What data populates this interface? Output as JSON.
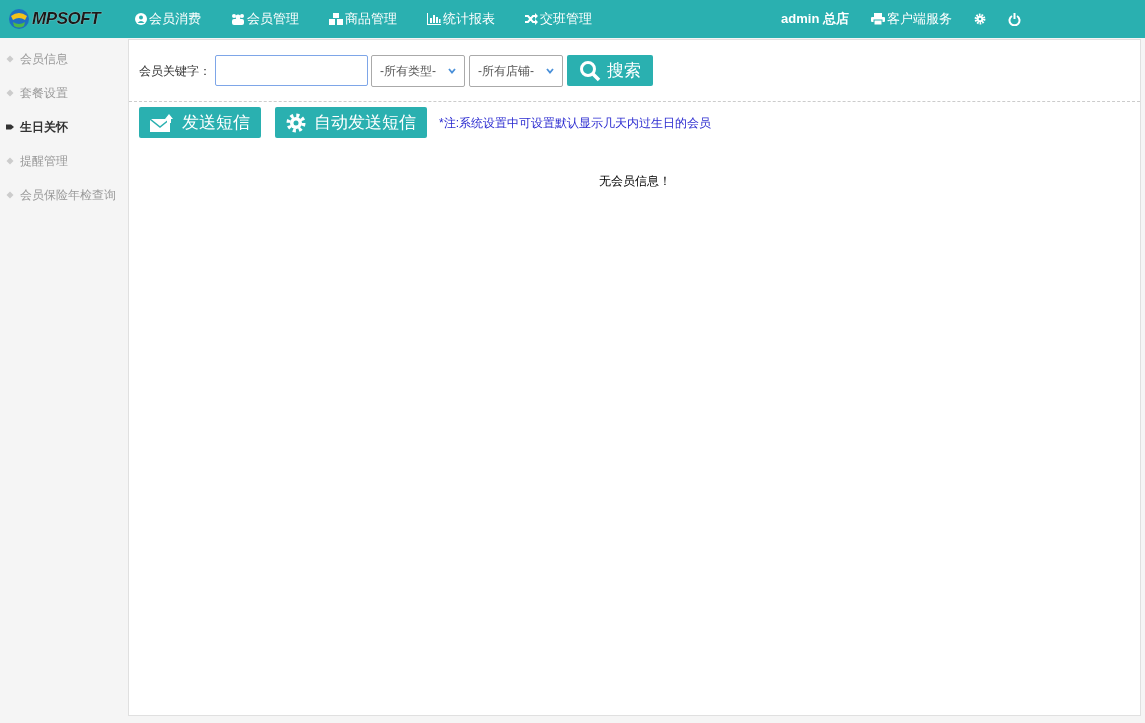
{
  "logo": {
    "text": "MPSOFT"
  },
  "nav": [
    {
      "label": "会员消费"
    },
    {
      "label": "会员管理"
    },
    {
      "label": "商品管理"
    },
    {
      "label": "统计报表"
    },
    {
      "label": "交班管理"
    }
  ],
  "user": {
    "label": "admin 总店"
  },
  "client_service": {
    "label": "客户端服务"
  },
  "sidebar": {
    "items": [
      {
        "label": "会员信息",
        "selected": false
      },
      {
        "label": "套餐设置",
        "selected": false
      },
      {
        "label": "生日关怀",
        "selected": true
      },
      {
        "label": "提醒管理",
        "selected": false
      },
      {
        "label": "会员保险年检查询",
        "selected": false
      }
    ]
  },
  "search": {
    "label": "会员关键字：",
    "type_select": "-所有类型-",
    "store_select": "-所有店铺-",
    "button": "搜索"
  },
  "actions": [
    {
      "label": "发送短信"
    },
    {
      "label": "自动发送短信"
    }
  ],
  "note": "*注:系统设置中可设置默认显示几天内过生日的会员",
  "empty_message": "无会员信息！"
}
